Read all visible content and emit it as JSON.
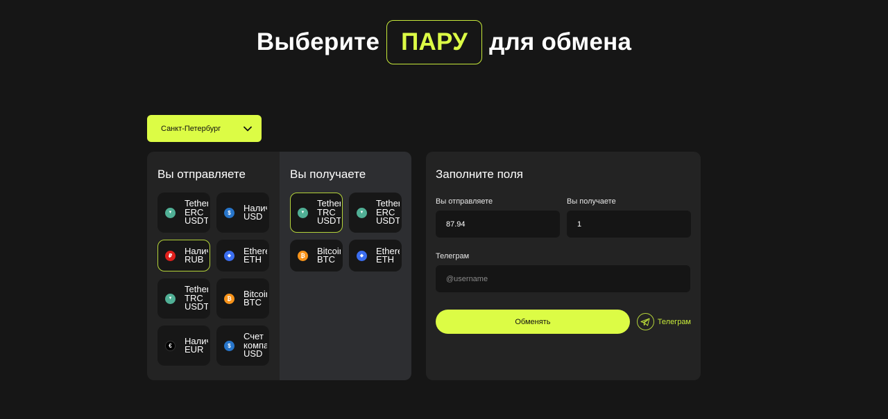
{
  "header": {
    "title_before": "Выберите",
    "title_accent": "ПАРУ",
    "title_after": "для обмена"
  },
  "city_select": {
    "value": "Санкт-Петербург",
    "icon": "chevron-down-icon"
  },
  "send": {
    "heading": "Вы отправляете",
    "items": [
      {
        "line1": "Tether",
        "line2": "ERC",
        "line3": "USDT",
        "icon": "tether-icon",
        "color": "#50af95",
        "active": false
      },
      {
        "line1": "Наличные",
        "line2": "USD",
        "line3": "",
        "icon": "dollar-icon",
        "color": "#2775ca",
        "active": false
      },
      {
        "line1": "Наличные",
        "line2": "RUB",
        "line3": "",
        "icon": "ruble-icon",
        "color": "#e0201c",
        "active": true
      },
      {
        "line1": "Ethereum",
        "line2": "ETH",
        "line3": "",
        "icon": "ethereum-icon",
        "color": "#3b6ef0",
        "active": false
      },
      {
        "line1": "Tether",
        "line2": "TRC",
        "line3": "USDT",
        "icon": "tether-icon",
        "color": "#50af95",
        "active": false
      },
      {
        "line1": "Bitcoin",
        "line2": "BTC",
        "line3": "",
        "icon": "bitcoin-icon",
        "color": "#f7931a",
        "active": false
      },
      {
        "line1": "Наличные",
        "line2": "EUR",
        "line3": "",
        "icon": "euro-icon",
        "color": "#000000",
        "active": false
      },
      {
        "line1": "Счет",
        "line2": "компании",
        "line3": "USD",
        "icon": "dollar-icon",
        "color": "#2775ca",
        "active": false
      }
    ]
  },
  "receive": {
    "heading": "Вы получаете",
    "items": [
      {
        "line1": "Tether",
        "line2": "TRC",
        "line3": "USDT",
        "icon": "tether-icon",
        "color": "#50af95",
        "active": true
      },
      {
        "line1": "Tether",
        "line2": "ERC",
        "line3": "USDT",
        "icon": "tether-icon",
        "color": "#50af95",
        "active": false
      },
      {
        "line1": "Bitcoin",
        "line2": "BTC",
        "line3": "",
        "icon": "bitcoin-icon",
        "color": "#f7931a",
        "active": false
      },
      {
        "line1": "Ethereum",
        "line2": "ETH",
        "line3": "",
        "icon": "ethereum-icon",
        "color": "#3b6ef0",
        "active": false
      }
    ]
  },
  "form": {
    "heading": "Заполните поля",
    "send_label": "Вы отправляете",
    "send_value": "87.94",
    "receive_label": "Вы получаете",
    "receive_value": "1",
    "telegram_label": "Телеграм",
    "telegram_placeholder": "@username",
    "submit_label": "Обменять",
    "telegram_link": "Телеграм"
  },
  "colors": {
    "accent": "#dcfc45",
    "background": "#161616",
    "panel": "#232323",
    "panel_alt": "#2d2e31"
  }
}
